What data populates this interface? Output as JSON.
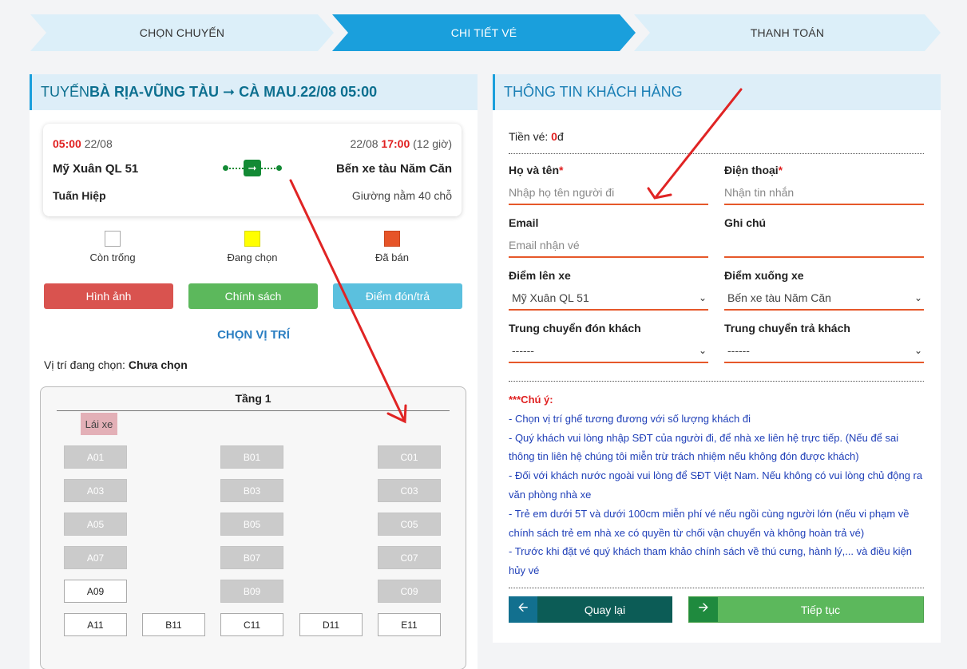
{
  "steps": [
    {
      "label": "CHỌN CHUYẾN"
    },
    {
      "label": "CHI TIẾT VÉ"
    },
    {
      "label": "THANH TOÁN"
    }
  ],
  "route_header": {
    "prefix": "TUYẾN ",
    "route": "BÀ RỊA-VŨNG TÀU ➞ CÀ MAU",
    "sep": ". ",
    "datetime": "22/08 05:00"
  },
  "trip": {
    "depart_time": "05:00",
    "depart_date": "22/08",
    "arrive_date": "22/08",
    "arrive_time": "17:00",
    "duration": "(12 giờ)",
    "origin": "Mỹ Xuân QL 51",
    "destination": "Bến xe tàu Năm Căn",
    "operator": "Tuấn Hiệp",
    "vehicle": "Giường nằm 40 chỗ"
  },
  "legend": [
    {
      "label": "Còn trống",
      "color": "#ffffff"
    },
    {
      "label": "Đang chọn",
      "color": "#ffff00"
    },
    {
      "label": "Đã bán",
      "color": "#e65428"
    }
  ],
  "buttons": {
    "images": "Hình ảnh",
    "policy": "Chính sách",
    "pickup": "Điểm đón/trả"
  },
  "choose_position": "CHỌN VỊ TRÍ",
  "selected_position_label": "Vị trí đang chọn: ",
  "selected_position_value": "Chưa chọn",
  "seatmap": {
    "floor": "Tầng 1",
    "driver": "Lái xe",
    "seats": {
      "A01": "A01",
      "B01": "B01",
      "C01": "C01",
      "A03": "A03",
      "B03": "B03",
      "C03": "C03",
      "A05": "A05",
      "B05": "B05",
      "C05": "C05",
      "A07": "A07",
      "B07": "B07",
      "C07": "C07",
      "A09": "A09",
      "B09": "B09",
      "C09": "C09",
      "A11": "A11",
      "B11": "B11",
      "C11": "C11",
      "D11": "D11",
      "E11": "E11"
    }
  },
  "customer": {
    "title": "THÔNG TIN KHÁCH HÀNG",
    "price_label": "Tiền vé: ",
    "price_value": "0",
    "price_unit": "đ",
    "name_label": "Họ và tên",
    "name_placeholder": "Nhập họ tên người đi",
    "phone_label": "Điện thoại",
    "phone_placeholder": "Nhận tin nhắn",
    "required_mark": "*",
    "email_label": "Email",
    "email_placeholder": "Email nhận vé",
    "note_label": "Ghi chú",
    "note_placeholder": "",
    "board_label": "Điểm lên xe",
    "board_value": "Mỹ Xuân QL 51",
    "drop_label": "Điểm xuống xe",
    "drop_value": "Bến xe tàu Năm Căn",
    "shuttle_pick_label": "Trung chuyển đón khách",
    "shuttle_pick_value": "------",
    "shuttle_drop_label": "Trung chuyển trả khách",
    "shuttle_drop_value": "------"
  },
  "notes": {
    "title": "***Chú ý:",
    "lines": [
      "- Chọn vị trí ghế tương đương với số lượng khách đi",
      "- Quý khách vui lòng nhập SĐT của người đi, để nhà xe liên hệ trực tiếp. (Nếu để sai thông tin liên hệ chúng tôi miễn trừ trách nhiệm nếu không đón được khách)",
      "- Đối với khách nước ngoài vui lòng để SĐT Việt Nam. Nếu không có vui lòng chủ động ra văn phòng nhà xe",
      "- Trẻ em dưới 5T và dưới 100cm miễn phí vé nếu ngồi cùng người lớn (nếu vi phạm về chính sách trẻ em nhà xe có quyền từ chối vận chuyển và không hoàn trả vé)",
      "- Trước khi đặt vé quý khách tham khảo chính sách về thú cưng, hành lý,... và điều kiện hủy vé"
    ]
  },
  "actions": {
    "back": "Quay lại",
    "next": "Tiếp tục"
  },
  "colors": {
    "accent": "#1a9fdc",
    "danger": "#d9534f",
    "success": "#5cb85c",
    "info": "#5bc0de",
    "dark_teal": "#0c5c56"
  }
}
